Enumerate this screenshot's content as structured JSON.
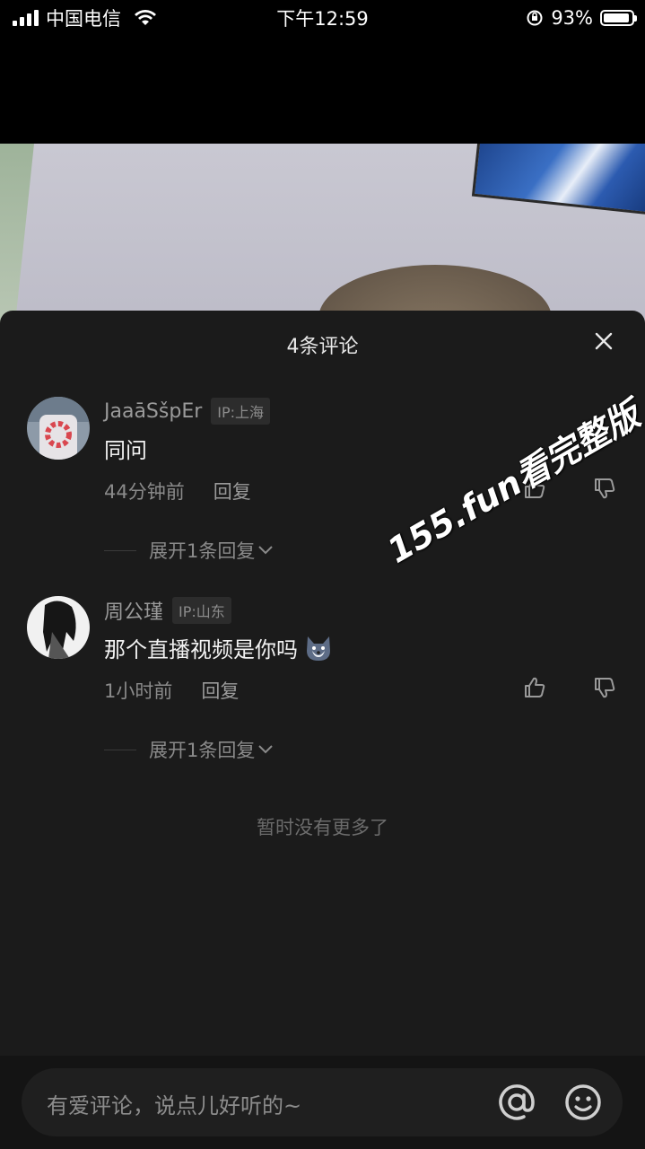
{
  "status_bar": {
    "carrier": "中国电信",
    "time": "下午12:59",
    "battery_percent": "93%",
    "battery_level": 0.93
  },
  "sheet": {
    "title": "4条评论",
    "no_more": "暂时没有更多了"
  },
  "comments": [
    {
      "username": "JaaāSšpEr",
      "ip": "IP:上海",
      "text": "同问",
      "time": "44分钟前",
      "reply_label": "回复",
      "expand_label": "展开1条回复"
    },
    {
      "username": "周公瑾",
      "ip": "IP:山东",
      "text": "那个直播视频是你吗",
      "emoji": "wolf-emoji",
      "time": "1小时前",
      "reply_label": "回复",
      "expand_label": "展开1条回复"
    }
  ],
  "watermark": "155.fun看完整版",
  "input": {
    "placeholder": "有爱评论，说点儿好听的~"
  },
  "colors": {
    "sheet_bg": "#1b1b1b",
    "text_primary": "#f2f2f2",
    "text_secondary": "#8a8a8a"
  }
}
